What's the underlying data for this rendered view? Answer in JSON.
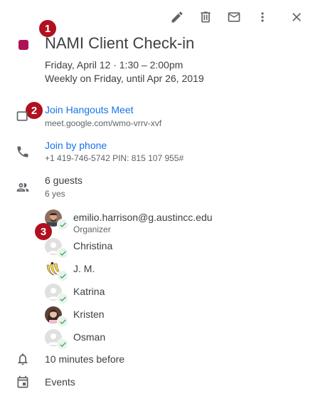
{
  "event": {
    "title": "NAMI Client Check-in",
    "date_time": "Friday, April 12  ·  1:30 – 2:00pm",
    "recurrence": "Weekly on Friday, until Apr 26, 2019",
    "color": "#ad1457"
  },
  "toolbar": {
    "icons": [
      "edit-icon",
      "delete-icon",
      "email-icon",
      "more-vert-icon",
      "close-icon"
    ]
  },
  "markers": [
    "1",
    "2",
    "3"
  ],
  "hangouts": {
    "label": "Join Hangouts Meet",
    "url": "meet.google.com/wmo-vrrv-xvf"
  },
  "phone": {
    "label": "Join by phone",
    "details": "+1 419-746-5742 PIN: 815 107 955#"
  },
  "guests": {
    "count_label": "6 guests",
    "yes_label": "6 yes",
    "list": [
      {
        "name": "emilio.harrison@g.austincc.edu",
        "role": "Organizer",
        "avatar": "photo-man"
      },
      {
        "name": "Christina",
        "role": "",
        "avatar": "default"
      },
      {
        "name": "J. M.",
        "role": "",
        "avatar": "bananas"
      },
      {
        "name": "Katrina",
        "role": "",
        "avatar": "default"
      },
      {
        "name": "Kristen",
        "role": "",
        "avatar": "photo-woman"
      },
      {
        "name": "Osman",
        "role": "",
        "avatar": "default"
      }
    ]
  },
  "reminder": {
    "label": "10 minutes before"
  },
  "calendar": {
    "label": "Events"
  }
}
